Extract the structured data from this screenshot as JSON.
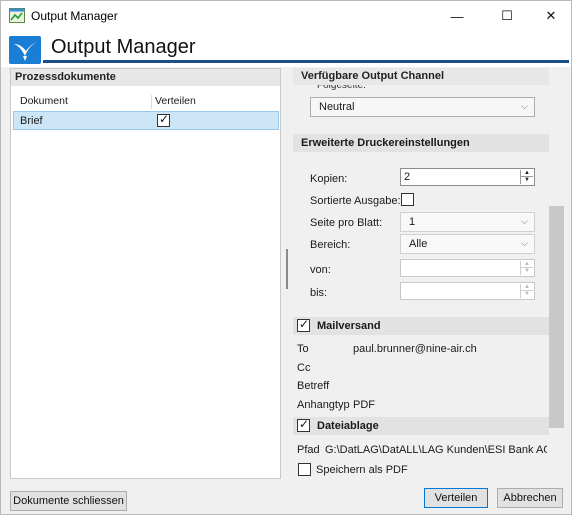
{
  "window": {
    "title": "Output Manager",
    "minimize": "—",
    "maximize": "☐",
    "close": "✕"
  },
  "header": {
    "title": "Output Manager"
  },
  "left": {
    "title": "Prozessdokumente",
    "columns": [
      "Dokument",
      "Verteilen"
    ],
    "rows": [
      {
        "dokument": "Brief",
        "verteilen": true
      }
    ]
  },
  "right": {
    "title": "Verfügbare Output Channel",
    "folgeseite_label": "Folgeseite:",
    "folgeseite_value": "Neutral",
    "druck": {
      "title": "Erweiterte Druckereinstellungen",
      "kopien_label": "Kopien:",
      "kopien_value": "2",
      "sortiert_label": "Sortierte Ausgabe:",
      "sortiert_checked": false,
      "seiten_label": "Seite pro Blatt:",
      "seiten_value": "1",
      "bereich_label": "Bereich:",
      "bereich_value": "Alle",
      "von_label": "von:",
      "bis_label": "bis:"
    },
    "mail": {
      "title": "Mailversand",
      "enabled": true,
      "to_label": "To",
      "to_value": "paul.brunner@nine-air.ch",
      "cc_label": "Cc",
      "betreff_label": "Betreff",
      "anhang_label": "Anhangtyp",
      "anhang_value": "PDF"
    },
    "ablage": {
      "title": "Dateiablage",
      "enabled": true,
      "pfad_label": "Pfad",
      "pfad_value": "G:\\DatLAG\\DatALL\\LAG Kunden\\ESI Bank AG\\SE\\",
      "pdf_label": "Speichern als PDF",
      "pdf_checked": false
    }
  },
  "footer": {
    "close_docs": "Dokumente schliessen",
    "verteilen": "Verteilen",
    "abbrechen": "Abbrechen"
  },
  "colors": {
    "accent": "#1b4f8a",
    "selection": "#cde6f7",
    "logo": "#1a7fd4"
  }
}
